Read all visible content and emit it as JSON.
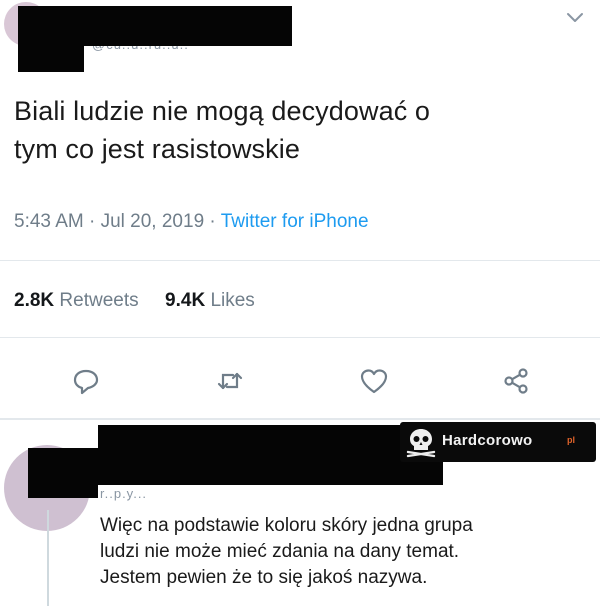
{
  "tweet": {
    "handle": "@cu..u..ru..u..",
    "text_line_1": "Biali ludzie nie mogą decydować o",
    "text_line_2": "tym co jest rasistowskie",
    "time": "5:43 AM",
    "date": "Jul 20, 2019",
    "source": "Twitter for iPhone",
    "separator": "·",
    "retweets_count": "2.8K",
    "retweets_label": "Retweets",
    "likes_count": "9.4K",
    "likes_label": "Likes"
  },
  "reply": {
    "handle_fragment": "r..p.y...",
    "line_1": "Więc na podstawie koloru skóry jedna grupa",
    "line_2": "ludzi nie może mieć zdania na dany temat.",
    "line_3": "Jestem pewien że to się jakoś nazywa."
  },
  "watermark": {
    "text": "Hardcorowo",
    "suffix": "pl"
  },
  "icons": {
    "chevron": "chevron-down-icon",
    "reply": "reply-icon",
    "retweet": "retweet-icon",
    "like": "heart-icon",
    "share": "share-icon"
  },
  "colors": {
    "text_primary": "#14171a",
    "text_secondary": "#6f7d89",
    "link": "#1d9bf0",
    "divider": "#e3e8ec",
    "redaction": "#050505"
  }
}
